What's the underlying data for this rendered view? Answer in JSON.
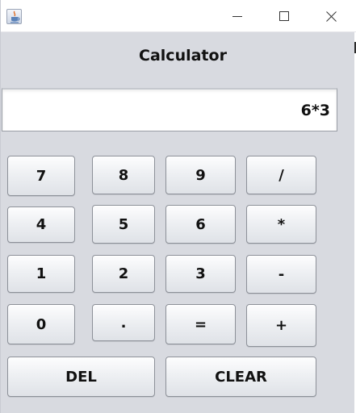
{
  "window": {
    "icon": "java-cup-icon",
    "controls": {
      "minimize": "minimize-icon",
      "maximize": "maximize-icon",
      "close": "close-icon"
    }
  },
  "heading": "Calculator",
  "display": {
    "value": "6*3"
  },
  "keys": {
    "k7": "7",
    "k8": "8",
    "k9": "9",
    "div": "/",
    "k4": "4",
    "k5": "5",
    "k6": "6",
    "mul": "*",
    "k1": "1",
    "k2": "2",
    "k3": "3",
    "sub": "-",
    "k0": "0",
    "dot": ".",
    "eq": "=",
    "add": "+",
    "del": "DEL",
    "clear": "CLEAR"
  }
}
